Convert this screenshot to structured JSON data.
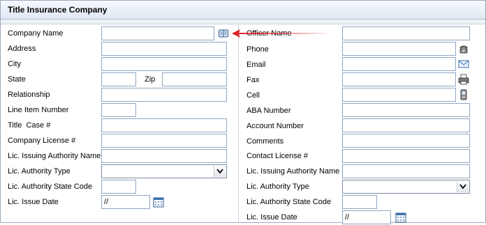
{
  "panel_title": "Title Insurance Company",
  "left": {
    "company_name": "Company Name",
    "address": "Address",
    "city": "City",
    "state": "State",
    "zip": "Zip",
    "relationship": "Relationship",
    "line_item_number": "Line Item Number",
    "title_case": "Title  Case #",
    "company_license": "Company License #",
    "lic_issuing_authority_name": "Lic. Issuing Authority Name",
    "lic_authority_type": "Lic. Authority Type",
    "lic_authority_state_code": "Lic. Authority State Code",
    "lic_issue_date": "Lic. Issue Date",
    "lic_issue_date_value": "//"
  },
  "right": {
    "officer_name": "Officer Name",
    "phone": "Phone",
    "email": "Email",
    "fax": "Fax",
    "cell": "Cell",
    "aba_number": "ABA Number",
    "account_number": "Account Number",
    "comments": "Comments",
    "contact_license": "Contact License #",
    "lic_issuing_authority_name": "Lic. Issuing Authority Name",
    "lic_authority_type": "Lic. Authority Type",
    "lic_authority_state_code": "Lic. Authority State Code",
    "lic_issue_date": "Lic. Issue Date",
    "lic_issue_date_value": "//"
  },
  "icons": {
    "company_lookup": "address-book-icon",
    "phone": "telephone-icon",
    "email": "envelope-icon",
    "fax": "fax-icon",
    "cell": "mobile-phone-icon",
    "calendar": "calendar-icon",
    "annotation": "red-arrow-icon"
  },
  "colors": {
    "field_border": "#8fa5c0",
    "annotation_arrow": "#e0202a",
    "title_bar": "#dfe8f3"
  }
}
